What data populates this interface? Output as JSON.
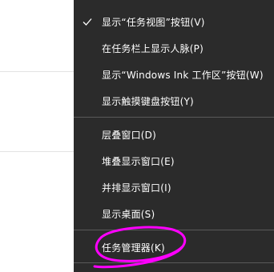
{
  "context_menu": {
    "items": [
      {
        "label": "显示“任务视图”按钮(V)",
        "checked": true
      },
      {
        "label": "在任务栏上显示人脉(P)",
        "checked": false
      },
      {
        "label": "显示“Windows Ink 工作区”按钮(W)",
        "checked": false
      },
      {
        "label": "显示触摸键盘按钮(Y)",
        "checked": false
      },
      {
        "label": "层叠窗口(D)",
        "checked": false
      },
      {
        "label": "堆叠显示窗口(E)",
        "checked": false
      },
      {
        "label": "并排显示窗口(I)",
        "checked": false
      },
      {
        "label": "显示桌面(S)",
        "checked": false
      },
      {
        "label": "任务管理器(K)",
        "checked": false
      }
    ]
  },
  "colors": {
    "menu_background": "#2b2b2b",
    "menu_text": "#ffffff",
    "separator": "#5a5a5a",
    "annotation_stroke": "#ff00ff"
  },
  "icons": {
    "check": "check-icon"
  }
}
